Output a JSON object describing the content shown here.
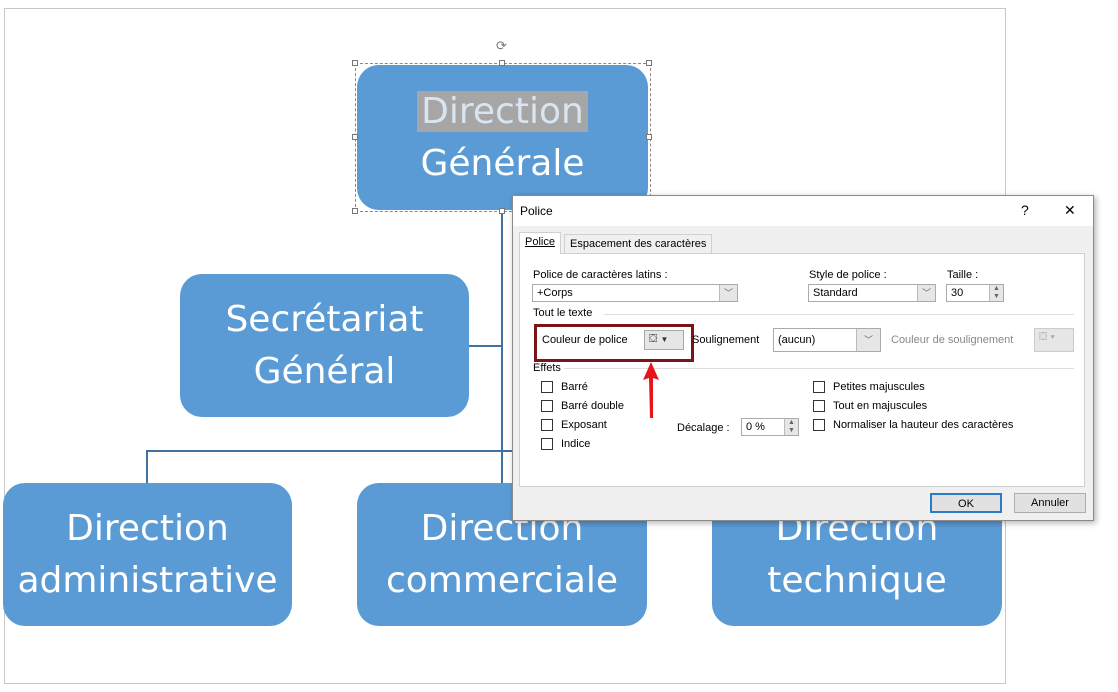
{
  "orgchart": {
    "top": {
      "line1": "Direction",
      "line2": "Générale"
    },
    "secretariat": {
      "line1": "Secrétariat",
      "line2": "Général"
    },
    "children": [
      {
        "line1": "Direction",
        "line2": "administrative"
      },
      {
        "line1": "Direction",
        "line2": "commerciale"
      },
      {
        "line1": "Direction",
        "line2": "technique"
      }
    ],
    "colors": {
      "box": "#5b9bd5",
      "connector": "#41719c"
    }
  },
  "dialog": {
    "title": "Police",
    "help": "?",
    "close": "✕",
    "tabs": [
      "Police",
      "Espacement des caractères"
    ],
    "latin_font_label": "Police de caractères latins :",
    "latin_font_value": "+Corps",
    "style_label": "Style de police :",
    "style_value": "Standard",
    "size_label": "Taille :",
    "size_value": "30",
    "all_text_label": "Tout le texte",
    "font_color_label": "Couleur de police",
    "underline_label": "Soulignement",
    "underline_value": "(aucun)",
    "underline_color_label": "Couleur de soulignement",
    "effects_label": "Effets",
    "effects_left": [
      "Barré",
      "Barré double",
      "Exposant",
      "Indice"
    ],
    "effects_right": [
      "Petites majuscules",
      "Tout en majuscules",
      "Normaliser la hauteur des caractères"
    ],
    "offset_label": "Décalage :",
    "offset_value": "0 %",
    "ok": "OK",
    "cancel": "Annuler",
    "highlight_color": "#7b1416",
    "arrow_color": "#e8141b"
  }
}
